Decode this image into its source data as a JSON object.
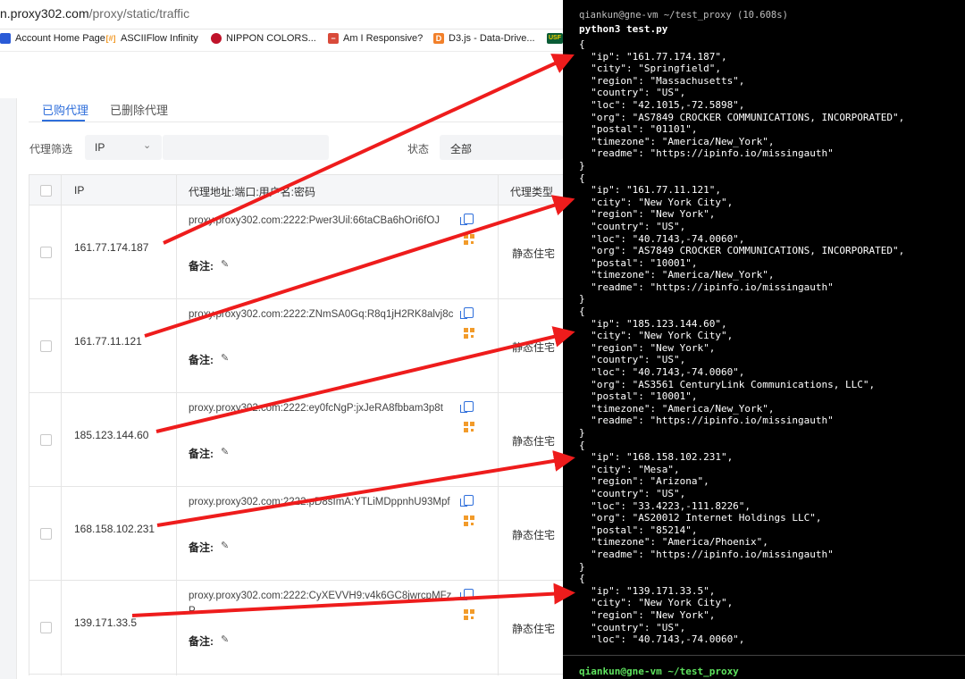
{
  "browser": {
    "url_host": "n.proxy302.com",
    "url_path": "/proxy/static/traffic",
    "bookmarks": [
      {
        "label": "Account Home Page",
        "icon": "blue-square-icon",
        "color": "#2a5bd7"
      },
      {
        "label": "ASCIIFlow Infinity",
        "icon": "asciiflow-icon",
        "color": "#f29b2a"
      },
      {
        "label": "NIPPON COLORS...",
        "icon": "red-circle-icon",
        "color": "#c0132a"
      },
      {
        "label": "Am I Responsive?",
        "icon": "red-square-icon",
        "color": "#d94a3a"
      },
      {
        "label": "D3.js - Data-Drive...",
        "icon": "d3-icon",
        "color": "#f2802a"
      },
      {
        "label": "USF",
        "icon": "usf-icon",
        "color": "#0a5c36"
      }
    ]
  },
  "page": {
    "tabs": [
      "已购代理",
      "已删除代理"
    ],
    "filter_label": "代理筛选",
    "filter_select_value": "IP",
    "status_label": "状态",
    "status_value": "全部",
    "table": {
      "headers": [
        "IP",
        "代理地址:端口:用户名:密码",
        "代理类型"
      ],
      "rows": [
        {
          "ip": "161.77.174.187",
          "address": "proxy.proxy302.com:2222:Pwer3Uil:66taCBa6hOri6fOJ",
          "note": "备注:",
          "type": "静态住宅"
        },
        {
          "ip": "161.77.11.121",
          "address": "proxy.proxy302.com:2222:ZNmSA0Gq:R8q1jH2RK8alvj8c",
          "note": "备注:",
          "type": "静态住宅"
        },
        {
          "ip": "185.123.144.60",
          "address": "proxy.proxy302.com:2222:ey0fcNgP:jxJeRA8fbbam3p8t",
          "note": "备注:",
          "type": "静态住宅"
        },
        {
          "ip": "168.158.102.231",
          "address": "proxy.proxy302.com:2222:pD8sImA:YTLiMDppnhU93Mpf",
          "note": "备注:",
          "type": "静态住宅"
        },
        {
          "ip": "139.171.33.5",
          "address": "proxy.proxy302.com:2222:CyXEVVH9:v4k6GC8jwrcpMFzP",
          "note": "备注:",
          "type": "静态住宅"
        }
      ]
    }
  },
  "terminal": {
    "title": "qiankun@gne-vm ~/test_proxy (10.608s)",
    "command": "python3 test.py",
    "lines": [
      "{",
      "  \"ip\": \"161.77.174.187\",",
      "  \"city\": \"Springfield\",",
      "  \"region\": \"Massachusetts\",",
      "  \"country\": \"US\",",
      "  \"loc\": \"42.1015,-72.5898\",",
      "  \"org\": \"AS7849 CROCKER COMMUNICATIONS, INCORPORATED\",",
      "  \"postal\": \"01101\",",
      "  \"timezone\": \"America/New_York\",",
      "  \"readme\": \"https://ipinfo.io/missingauth\"",
      "}",
      "{",
      "  \"ip\": \"161.77.11.121\",",
      "  \"city\": \"New York City\",",
      "  \"region\": \"New York\",",
      "  \"country\": \"US\",",
      "  \"loc\": \"40.7143,-74.0060\",",
      "  \"org\": \"AS7849 CROCKER COMMUNICATIONS, INCORPORATED\",",
      "  \"postal\": \"10001\",",
      "  \"timezone\": \"America/New_York\",",
      "  \"readme\": \"https://ipinfo.io/missingauth\"",
      "}",
      "{",
      "  \"ip\": \"185.123.144.60\",",
      "  \"city\": \"New York City\",",
      "  \"region\": \"New York\",",
      "  \"country\": \"US\",",
      "  \"loc\": \"40.7143,-74.0060\",",
      "  \"org\": \"AS3561 CenturyLink Communications, LLC\",",
      "  \"postal\": \"10001\",",
      "  \"timezone\": \"America/New_York\",",
      "  \"readme\": \"https://ipinfo.io/missingauth\"",
      "}",
      "{",
      "  \"ip\": \"168.158.102.231\",",
      "  \"city\": \"Mesa\",",
      "  \"region\": \"Arizona\",",
      "  \"country\": \"US\",",
      "  \"loc\": \"33.4223,-111.8226\",",
      "  \"org\": \"AS20012 Internet Holdings LLC\",",
      "  \"postal\": \"85214\",",
      "  \"timezone\": \"America/Phoenix\",",
      "  \"readme\": \"https://ipinfo.io/missingauth\"",
      "}",
      "{",
      "  \"ip\": \"139.171.33.5\",",
      "  \"city\": \"New York City\",",
      "  \"region\": \"New York\",",
      "  \"country\": \"US\",",
      "  \"loc\": \"40.7143,-74.0060\","
    ],
    "prompt": "qiankun@gne-vm ~/test_proxy"
  },
  "colors": {
    "accent": "#2f6fdb",
    "arrow": "#ee1c1c",
    "prompt": "#5ee35e"
  }
}
